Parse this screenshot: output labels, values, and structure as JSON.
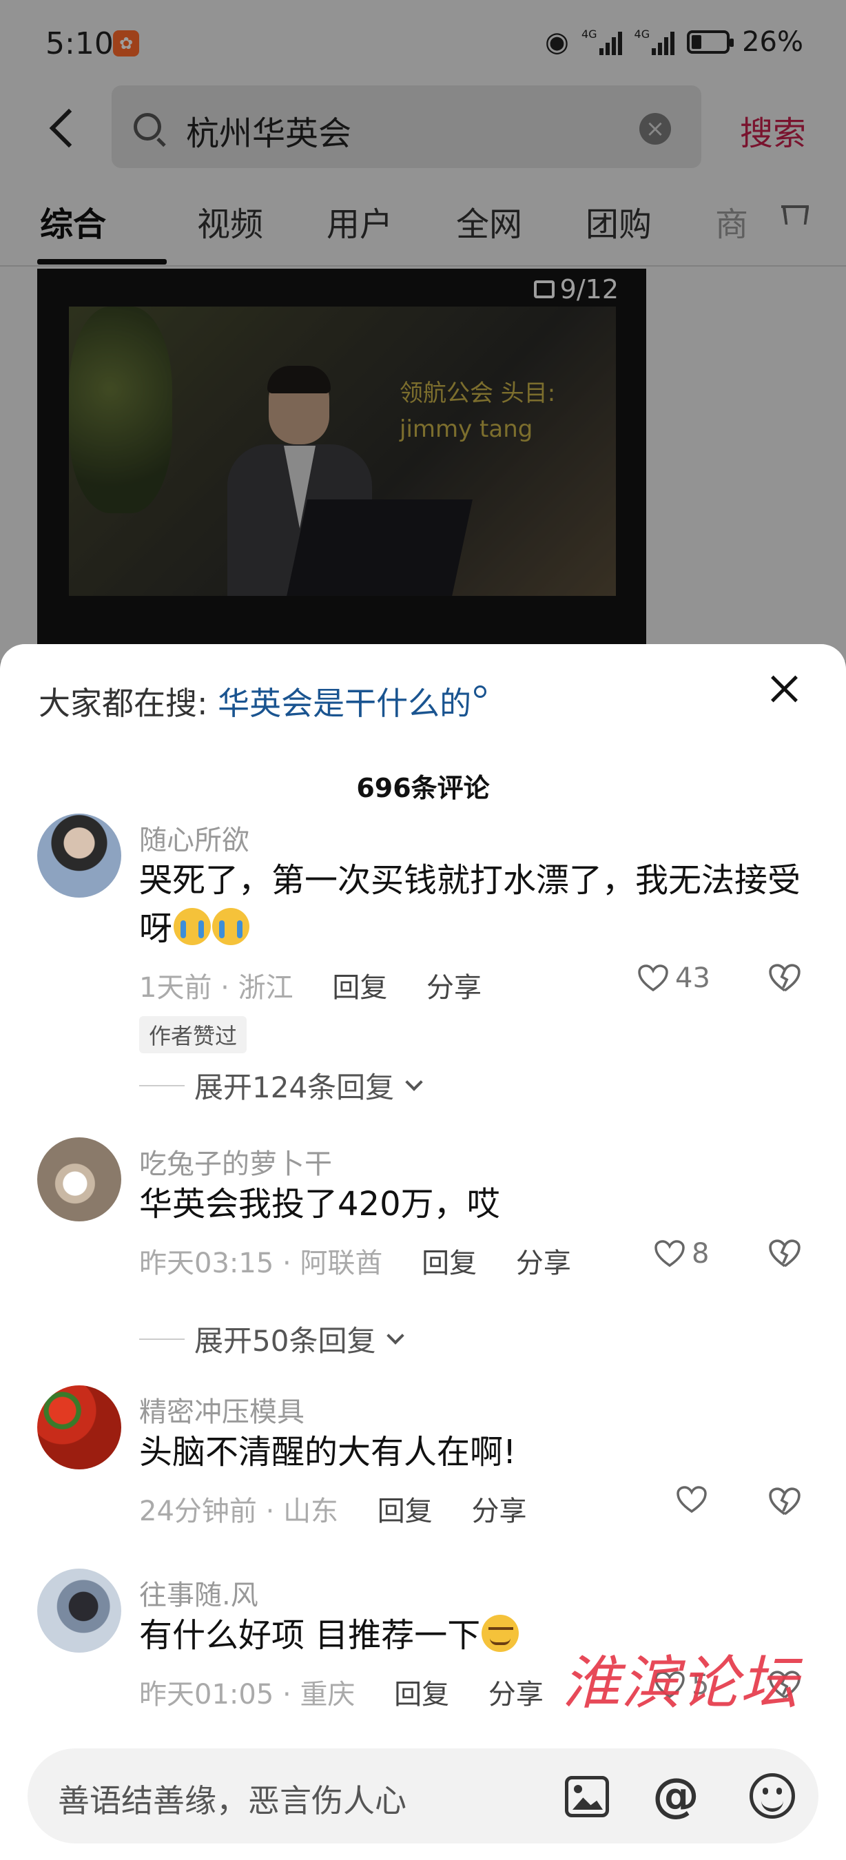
{
  "status_bar": {
    "time": "5:10",
    "battery": "26%",
    "network_1": "4G",
    "network_2": "4G"
  },
  "search": {
    "query": "杭州华英会",
    "button": "搜索"
  },
  "tabs": [
    "综合",
    "视频",
    "用户",
    "全网",
    "团购",
    "商"
  ],
  "active_tab": "综合",
  "video": {
    "counter": "9/12",
    "caption_line1": "领航公会 头目:",
    "caption_line2": "jimmy tang"
  },
  "comments_panel": {
    "trending_prefix": "大家都在搜:",
    "trending_query": "华英会是干什么的",
    "count_label": "696条评论"
  },
  "comments": [
    {
      "user": "随心所欲",
      "text": "哭死了，第一次买钱就打水漂了，我无法接受呀",
      "emoji": [
        "loudly-crying",
        "loudly-crying"
      ],
      "time": "1天前",
      "location": "浙江",
      "reply": "回复",
      "share": "分享",
      "likes": "43",
      "tag": "作者赞过",
      "expand": "展开124条回复"
    },
    {
      "user": "吃兔子的萝卜干",
      "text": "华英会我投了420万，哎",
      "time": "昨天03:15",
      "location": "阿联酋",
      "reply": "回复",
      "share": "分享",
      "likes": "8",
      "expand": "展开50条回复"
    },
    {
      "user": "精密冲压模具",
      "text": "头脑不清醒的大有人在啊!",
      "time": "24分钟前",
      "location": "山东",
      "reply": "回复",
      "share": "分享",
      "likes": ""
    },
    {
      "user": "往事随.风",
      "text": "有什么好项  目推荐一下",
      "emoji": [
        "smirk"
      ],
      "time": "昨天01:05",
      "location": "重庆",
      "reply": "回复",
      "share": "分享",
      "likes": "5"
    }
  ],
  "watermark": "淮滨论坛",
  "input": {
    "placeholder": "善语结善缘，恶言伤人心"
  },
  "colors": {
    "accent_red": "#c4204b",
    "link_blue": "#1a5490",
    "watermark_red": "#e63a4a"
  }
}
